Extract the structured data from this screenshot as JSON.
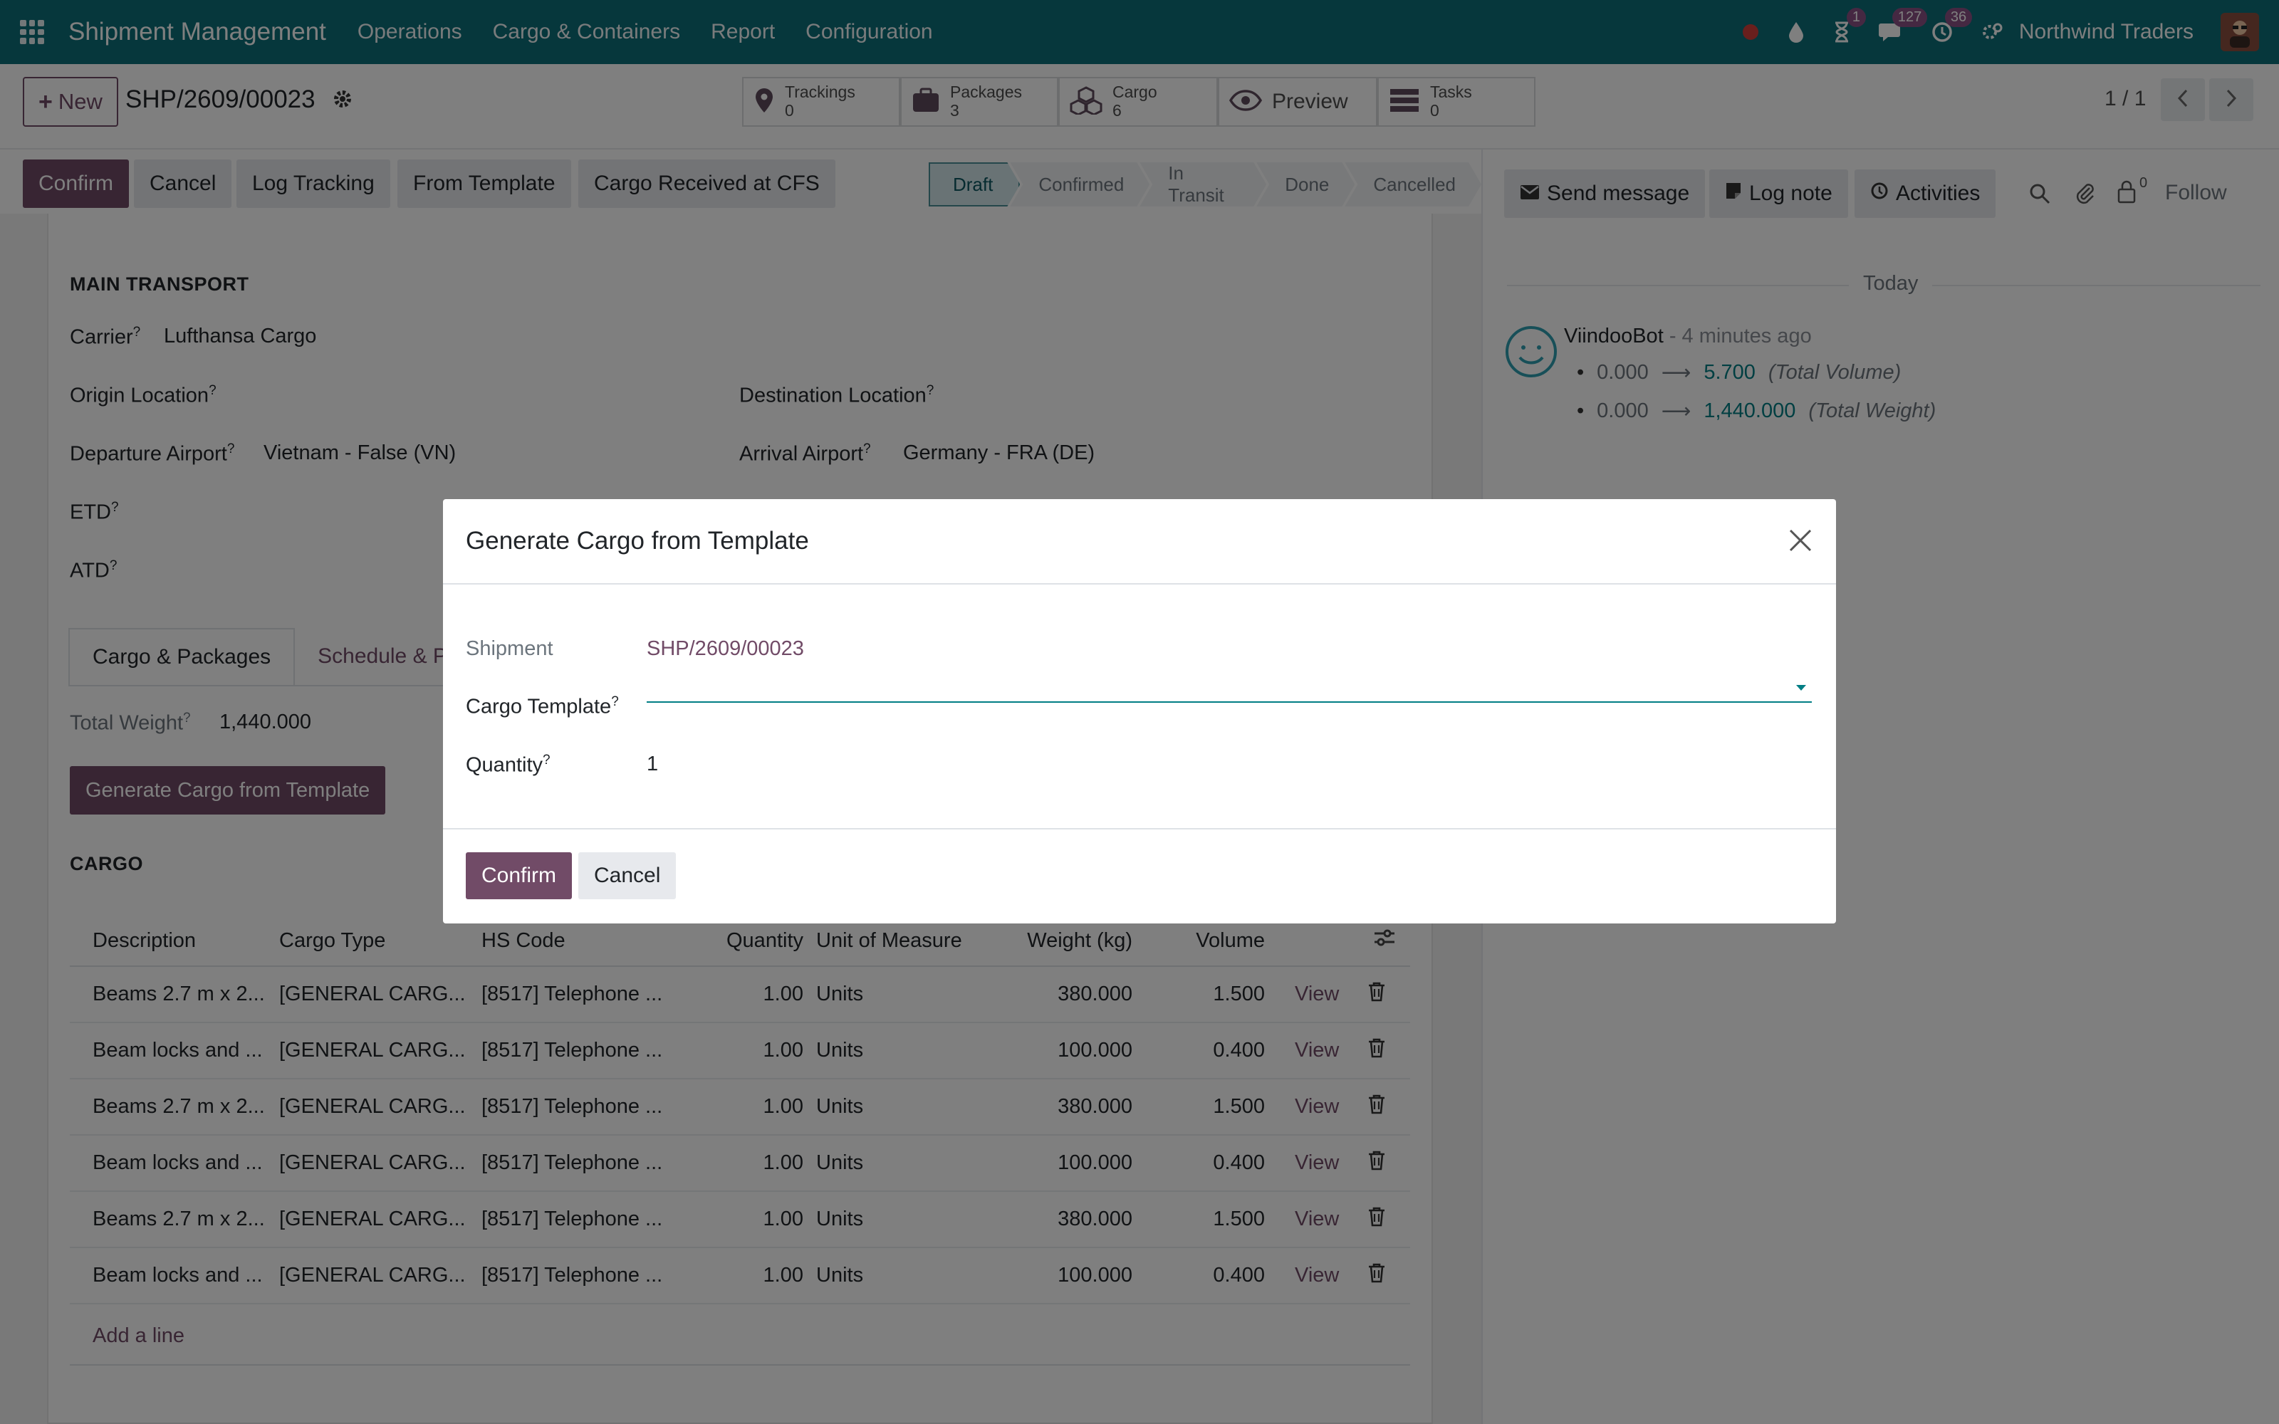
{
  "navbar": {
    "brand": "Shipment Management",
    "menus": [
      "Operations",
      "Cargo & Containers",
      "Report",
      "Configuration"
    ],
    "activity_badge": "1",
    "messages_badge": "127",
    "updates_badge": "36",
    "company": "Northwind Traders"
  },
  "control_panel": {
    "new_label": "New",
    "record_name": "SHP/2609/00023",
    "smart_buttons": [
      {
        "label": "Trackings",
        "value": "0"
      },
      {
        "label": "Packages",
        "value": "3"
      },
      {
        "label": "Cargo",
        "value": "6"
      },
      {
        "label": "Preview",
        "value": ""
      },
      {
        "label": "Tasks",
        "value": "0"
      }
    ],
    "pager": "1 / 1"
  },
  "statusbar": {
    "buttons": [
      "Confirm",
      "Cancel",
      "Log Tracking",
      "From Template",
      "Cargo Received at CFS"
    ],
    "stages": [
      "Draft",
      "Confirmed",
      "In Transit",
      "Done",
      "Cancelled"
    ],
    "active_stage": "Draft"
  },
  "form": {
    "section_title": "MAIN TRANSPORT",
    "carrier_label": "Carrier",
    "carrier_value": "Lufthansa Cargo",
    "origin_label": "Origin Location",
    "destination_label": "Destination Location",
    "departure_label": "Departure Airport",
    "departure_value": "Vietnam - False (VN)",
    "arrival_label": "Arrival Airport",
    "arrival_value": "Germany - FRA (DE)",
    "etd_label": "ETD",
    "atd_label": "ATD",
    "tabs": [
      "Cargo & Packages",
      "Schedule & Pe"
    ],
    "total_weight_label": "Total Weight",
    "total_weight_value": "1,440.000",
    "generate_button": "Generate Cargo from Template",
    "cargo_title": "CARGO",
    "columns": [
      "Description",
      "Cargo Type",
      "HS Code",
      "Quantity",
      "Unit of Measure",
      "Weight (kg)",
      "Volume"
    ],
    "rows": [
      {
        "description": "Beams 2.7 m x 2...",
        "type": "[GENERAL CARG...",
        "hs": "[8517] Telephone ...",
        "qty": "1.00",
        "uom": "Units",
        "weight": "380.000",
        "volume": "1.500",
        "action": "View"
      },
      {
        "description": "Beam locks and ...",
        "type": "[GENERAL CARG...",
        "hs": "[8517] Telephone ...",
        "qty": "1.00",
        "uom": "Units",
        "weight": "100.000",
        "volume": "0.400",
        "action": "View"
      },
      {
        "description": "Beams 2.7 m x 2...",
        "type": "[GENERAL CARG...",
        "hs": "[8517] Telephone ...",
        "qty": "1.00",
        "uom": "Units",
        "weight": "380.000",
        "volume": "1.500",
        "action": "View"
      },
      {
        "description": "Beam locks and ...",
        "type": "[GENERAL CARG...",
        "hs": "[8517] Telephone ...",
        "qty": "1.00",
        "uom": "Units",
        "weight": "100.000",
        "volume": "0.400",
        "action": "View"
      },
      {
        "description": "Beams 2.7 m x 2...",
        "type": "[GENERAL CARG...",
        "hs": "[8517] Telephone ...",
        "qty": "1.00",
        "uom": "Units",
        "weight": "380.000",
        "volume": "1.500",
        "action": "View"
      },
      {
        "description": "Beam locks and ...",
        "type": "[GENERAL CARG...",
        "hs": "[8517] Telephone ...",
        "qty": "1.00",
        "uom": "Units",
        "weight": "100.000",
        "volume": "0.400",
        "action": "View"
      }
    ],
    "add_line": "Add a line"
  },
  "chatter": {
    "send_message": "Send message",
    "log_note": "Log note",
    "activities": "Activities",
    "followers_count": "0",
    "follow": "Follow",
    "today": "Today",
    "author": "ViindooBot",
    "time": "- 4 minutes ago",
    "changes": [
      {
        "old": "0.000",
        "new": "5.700",
        "field": "(Total Volume)"
      },
      {
        "old": "0.000",
        "new": "1,440.000",
        "field": "(Total Weight)"
      }
    ]
  },
  "dialog": {
    "title": "Generate Cargo from Template",
    "shipment_label": "Shipment",
    "shipment_value": "SHP/2609/00023",
    "template_label": "Cargo Template",
    "template_value": "",
    "quantity_label": "Quantity",
    "quantity_value": "1",
    "confirm": "Confirm",
    "cancel": "Cancel"
  }
}
